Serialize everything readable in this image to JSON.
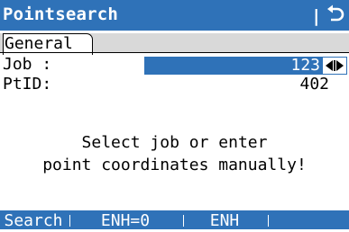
{
  "window": {
    "title": "Pointsearch",
    "title_separator": "|",
    "back_icon": "back-arrow-icon"
  },
  "tabs": [
    {
      "label": "General",
      "active": true
    }
  ],
  "fields": {
    "job": {
      "label": "Job :",
      "value": "123",
      "control_icon": "left-right-arrows-icon"
    },
    "ptid": {
      "label": "PtID:",
      "value": "402"
    }
  },
  "message": {
    "line1": "Select job or enter",
    "line2": "point coordinates manually!"
  },
  "softkeys": [
    {
      "label": "Search"
    },
    {
      "label": "ENH=0"
    },
    {
      "label": "ENH"
    },
    {
      "label": ""
    },
    {
      "label": ""
    }
  ],
  "colors": {
    "accent": "#2f72b8",
    "tab_strip": "#d9d9d9",
    "background": "#ffffff"
  }
}
